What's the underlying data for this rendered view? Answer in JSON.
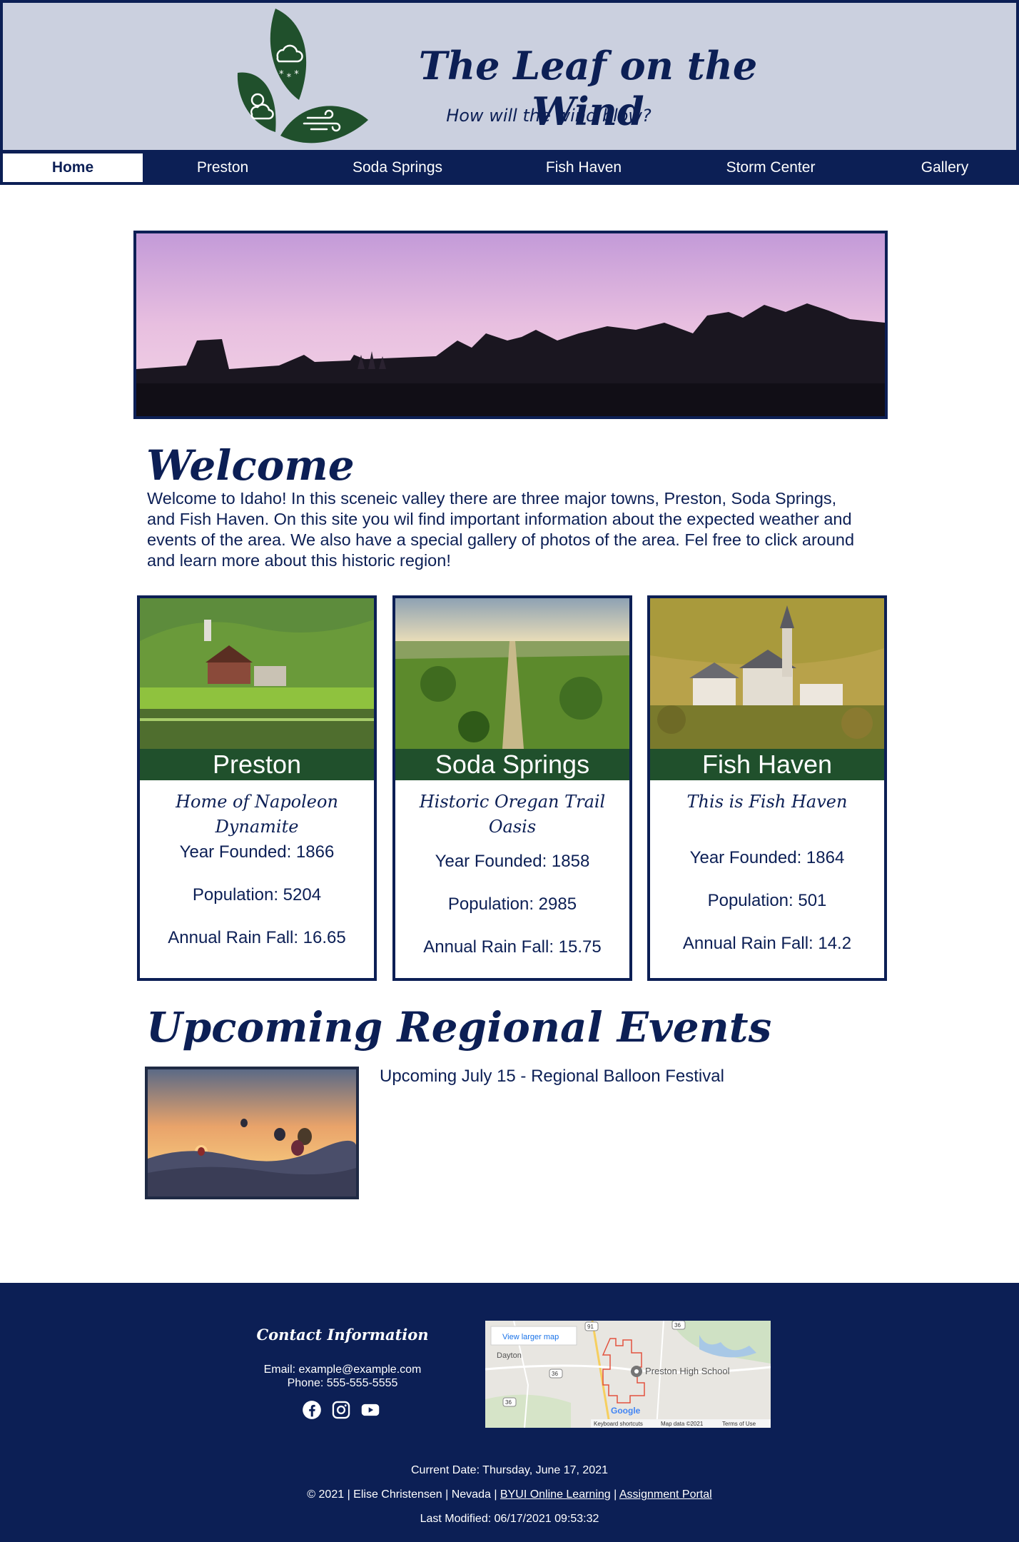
{
  "header": {
    "title": "The Leaf on the Wind",
    "tagline": "How will the wind blow?"
  },
  "nav": {
    "items": [
      {
        "label": "Home",
        "active": true
      },
      {
        "label": "Preston"
      },
      {
        "label": "Soda Springs"
      },
      {
        "label": "Fish Haven"
      },
      {
        "label": "Storm Center"
      },
      {
        "label": "Gallery"
      }
    ]
  },
  "welcome": {
    "heading": "Welcome",
    "text": "Welcome to Idaho! In this sceneic valley there are three major towns, Preston, Soda Springs, and Fish Haven. On this site you wil find important information about the expected weather and events of the area. We also have a special gallery of photos of the area. Fel free to click around and learn more about this historic region!"
  },
  "towns": [
    {
      "name": "Preston",
      "motto": "Home of Napoleon Dynamite",
      "founded": "Year Founded: 1866",
      "population": "Population: 5204",
      "rain": "Annual Rain Fall: 16.65"
    },
    {
      "name": "Soda Springs",
      "motto": "Historic Oregan Trail Oasis",
      "founded": "Year Founded: 1858",
      "population": "Population: 2985",
      "rain": "Annual Rain Fall: 15.75"
    },
    {
      "name": "Fish Haven",
      "motto": "This is Fish Haven",
      "founded": "Year Founded: 1864",
      "population": "Population: 501",
      "rain": "Annual Rain Fall: 14.2"
    }
  ],
  "events": {
    "heading": "Upcoming Regional Events",
    "item": "Upcoming July 15 - Regional Balloon Festival"
  },
  "footer": {
    "contact_heading": "Contact Information",
    "email": "Email: example@example.com",
    "phone": "Phone: 555-555-5555",
    "social_icons": [
      "facebook-icon",
      "instagram-icon",
      "youtube-icon"
    ],
    "map": {
      "larger_map_link": "View larger map",
      "place": "Preston High School",
      "town": "Dayton",
      "shortcuts": "Keyboard shortcuts",
      "map_data": "Map data ©2021",
      "terms": "Terms of Use",
      "routes": [
        "91",
        "36",
        "36",
        "36"
      ]
    },
    "current_date": "Current Date: Thursday, June 17, 2021",
    "copyright_prefix": "© 2021 | Elise Christensen | Nevada | ",
    "link_byui": "BYUI Online Learning",
    "separator": " | ",
    "link_portal": "Assignment Portal",
    "last_modified": "Last Modified: 06/17/2021 09:53:32"
  },
  "colors": {
    "navy": "#0c1f55",
    "header_bg": "#cbd0df",
    "forest_green": "#20502c"
  }
}
